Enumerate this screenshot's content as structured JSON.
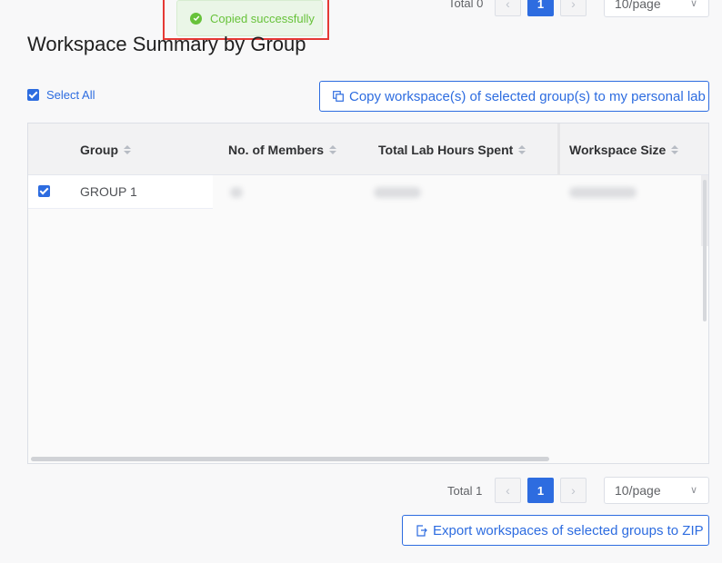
{
  "top_pagination": {
    "total": "Total 0",
    "prev_icon": "chevron-left",
    "current_page": "1",
    "next_icon": "chevron-right",
    "page_size": "10/page"
  },
  "toast": {
    "message": "Copied successfully",
    "icon": "check-circle",
    "color": "#67c23a"
  },
  "page_title": "Workspace Summary by Group",
  "select_all_label": "Select All",
  "copy_button_label": "Copy workspace(s) of selected group(s) to my personal lab",
  "table": {
    "columns": [
      {
        "label": "Group"
      },
      {
        "label": "No. of Members"
      },
      {
        "label": "Total Lab Hours Spent"
      },
      {
        "label": "Workspace Size"
      }
    ],
    "rows": [
      {
        "group": "GROUP 1",
        "checked": true
      }
    ]
  },
  "bottom_pagination": {
    "total": "Total 1",
    "prev_icon": "chevron-left",
    "current_page": "1",
    "next_icon": "chevron-right",
    "page_size": "10/page"
  },
  "export_button_label": "Export workspaces of selected groups to ZIP",
  "colors": {
    "accent": "#2d6ce0",
    "success": "#67c23a",
    "highlight_outline": "#e53935"
  }
}
